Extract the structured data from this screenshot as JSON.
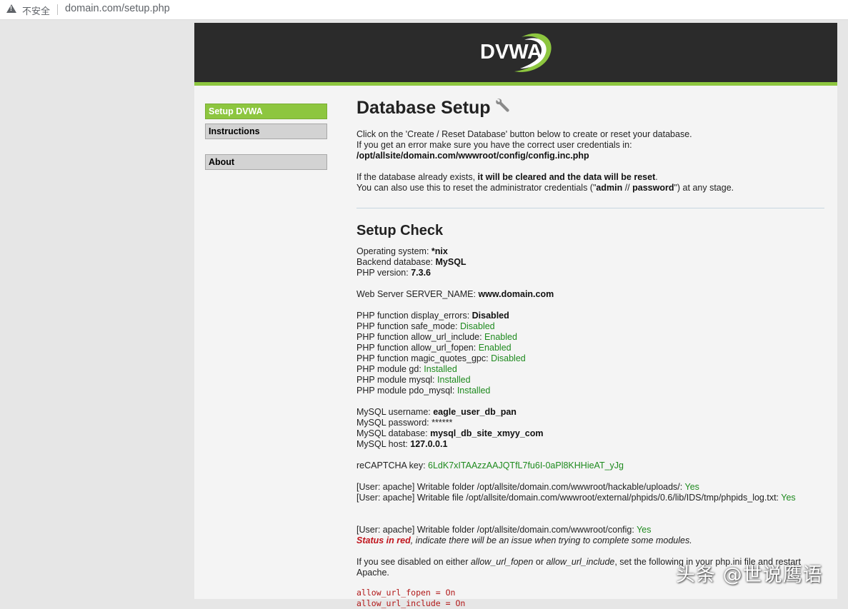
{
  "browser": {
    "insecure_label": "不安全",
    "url": "domain.com/setup.php"
  },
  "logo": {
    "text": "DVWA"
  },
  "menu": {
    "items": [
      {
        "label": "Setup DVWA",
        "selected": true
      },
      {
        "label": "Instructions",
        "selected": false
      },
      {
        "label": "About",
        "selected": false
      }
    ]
  },
  "intro": {
    "title": "Database Setup",
    "line1": "Click on the 'Create / Reset Database' button below to create or reset your database.",
    "line2": "If you get an error make sure you have the correct user credentials in:",
    "config_path": "/opt/allsite/domain.com/wwwroot/config/config.inc.php",
    "line3_pre": "If the database already exists, ",
    "line3_bold": "it will be cleared and the data will be reset",
    "line3_post": ".",
    "line4_pre": "You can also use this to reset the administrator credentials (\"",
    "line4_user": "admin",
    "line4_mid": " // ",
    "line4_pass": "password",
    "line4_post": "\") at any stage."
  },
  "check": {
    "title": "Setup Check",
    "os_label": "Operating system: ",
    "os_value": "*nix",
    "db_label": "Backend database: ",
    "db_value": "MySQL",
    "php_label": "PHP version: ",
    "php_value": "7.3.6",
    "server_label": "Web Server SERVER_NAME: ",
    "server_value": "www.domain.com",
    "functions": [
      {
        "label": "PHP function display_errors: ",
        "value": "Disabled",
        "style": "bold"
      },
      {
        "label": "PHP function safe_mode: ",
        "value": "Disabled",
        "style": "green"
      },
      {
        "label": "PHP function allow_url_include: ",
        "value": "Enabled",
        "style": "green"
      },
      {
        "label": "PHP function allow_url_fopen: ",
        "value": "Enabled",
        "style": "green"
      },
      {
        "label": "PHP function magic_quotes_gpc: ",
        "value": "Disabled",
        "style": "green"
      },
      {
        "label": "PHP module gd: ",
        "value": "Installed",
        "style": "green"
      },
      {
        "label": "PHP module mysql: ",
        "value": "Installed",
        "style": "green"
      },
      {
        "label": "PHP module pdo_mysql: ",
        "value": "Installed",
        "style": "green"
      }
    ],
    "mysql": [
      {
        "label": "MySQL username: ",
        "value": "eagle_user_db_pan",
        "style": "bold"
      },
      {
        "label": "MySQL password: ",
        "value": "******",
        "style": "plain"
      },
      {
        "label": "MySQL database: ",
        "value": "mysql_db_site_xmyy_com",
        "style": "bold"
      },
      {
        "label": "MySQL host: ",
        "value": "127.0.0.1",
        "style": "bold"
      }
    ],
    "recaptcha_label": "reCAPTCHA key: ",
    "recaptcha_value": "6LdK7xITAAzzAAJQTfL7fu6I-0aPl8KHHieAT_yJg",
    "writable1_label": "[User: apache] Writable folder /opt/allsite/domain.com/wwwroot/hackable/uploads/: ",
    "writable1_value": "Yes",
    "writable2_label": "[User: apache] Writable file /opt/allsite/domain.com/wwwroot/external/phpids/0.6/lib/IDS/tmp/phpids_log.txt: ",
    "writable2_value": "Yes",
    "writable3_label": "[User: apache] Writable folder /opt/allsite/domain.com/wwwroot/config: ",
    "writable3_value": "Yes",
    "status_red": "Status in red",
    "status_rest": ", indicate there will be an issue when trying to complete some modules.",
    "disabled_pre": "If you see disabled on either ",
    "disabled_fopen": "allow_url_fopen",
    "disabled_or": " or ",
    "disabled_include": "allow_url_include",
    "disabled_post": ", set the following in your php.ini file and restart",
    "disabled_line2": "Apache.",
    "code1": "allow_url_fopen = On",
    "code2": "allow_url_include = On"
  },
  "watermark": "头条 @世说鹰语"
}
